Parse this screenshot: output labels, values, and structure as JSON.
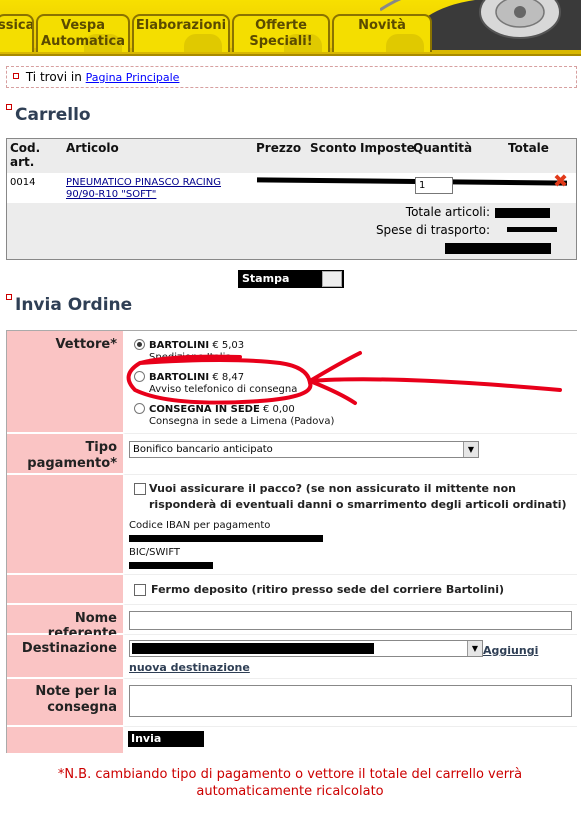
{
  "nav": {
    "tabs": [
      {
        "label": "ssica"
      },
      {
        "label": "Vespa\nAutomatica"
      },
      {
        "label": "Elaborazioni"
      },
      {
        "label": "Offerte\nSpeciali!"
      },
      {
        "label": "Novità"
      }
    ]
  },
  "breadcrumb": {
    "prefix": "Ti trovi in",
    "link": "Pagina Principale"
  },
  "cart": {
    "title": "Carrello",
    "headers": [
      "Cod. art.",
      "Articolo",
      "Prezzo",
      "Sconto",
      "Imposte",
      "Quantità",
      "Totale"
    ],
    "rows": [
      {
        "code": "0014",
        "article": "PNEUMATICO PINASCO RACING 90/90-R10 \"SOFT\"",
        "quantity": "1"
      }
    ],
    "totals": {
      "items_label": "Totale articoli:",
      "shipping_label": "Spese di trasporto:"
    }
  },
  "print_button": "Stampa",
  "order": {
    "title": "Invia Ordine",
    "carrier_label": "Vettore*",
    "carriers": [
      {
        "name": "BARTOLINI",
        "price": "€ 5,03",
        "desc": "Spedizione Italia",
        "selected": true
      },
      {
        "name": "BARTOLINI",
        "price": "€ 8,47",
        "desc": "Avviso telefonico di consegna",
        "selected": false
      },
      {
        "name": "CONSEGNA IN SEDE",
        "price": "€ 0,00",
        "desc": "Consegna in sede a Limena (Padova)",
        "selected": false
      }
    ],
    "payment_label": "Tipo pagamento*",
    "payment_value": "Bonifico bancario anticipato",
    "insure_text": "Vuoi assicurare il pacco? (se non assicurato il mittente non risponderà di eventuali danni o smarrimento degli articoli ordinati)",
    "iban_label": "Codice IBAN per pagamento",
    "bic_label": "BIC/SWIFT",
    "depot_text": "Fermo deposito (ritiro presso sede del corriere Bartolini)",
    "referent_label": "Nome referente",
    "destination_label": "Destinazione",
    "add_destination_link": "Aggiungi nuova destinazione",
    "notes_label": "Note per la consegna",
    "submit_label": "Invia Ordine"
  },
  "footnote": "*N.B. cambiando tipo di pagamento o vettore il totale del carrello verrà automaticamente ricalcolato",
  "colors": {
    "nav_yellow": "#f4de00",
    "label_pink": "#fac4c4",
    "annotation_red": "#e8001a",
    "note_red": "#cc0000"
  }
}
